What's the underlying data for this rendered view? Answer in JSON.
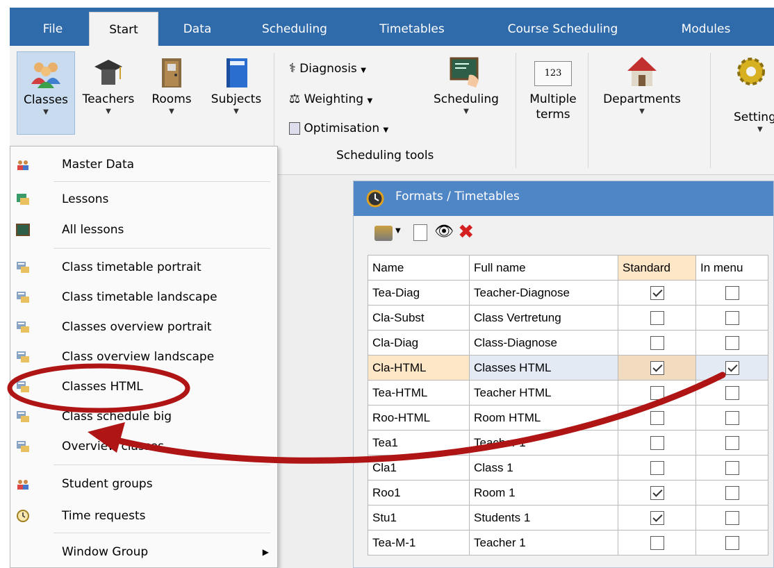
{
  "menubar": {
    "tabs": [
      "File",
      "Start",
      "Data",
      "Scheduling",
      "Timetables",
      "Course Scheduling",
      "Modules"
    ],
    "active_tab": "Start"
  },
  "ribbon": {
    "buttons": {
      "classes": "Classes",
      "teachers": "Teachers",
      "rooms": "Rooms",
      "subjects": "Subjects",
      "scheduling": "Scheduling",
      "multiple_terms_line1": "Multiple",
      "multiple_terms_line2": "terms",
      "departments": "Departments",
      "settings": "Setting"
    },
    "tools": {
      "diagnosis": "Diagnosis",
      "weighting": "Weighting",
      "optimisation": "Optimisation"
    },
    "group_label": "Scheduling tools",
    "multiple_terms_icon_text": "123"
  },
  "menu": {
    "items": [
      "Master Data",
      "Lessons",
      "All lessons",
      "Class timetable portrait",
      "Class timetable landscape",
      "Classes overview portrait",
      "Class overview landscape",
      "Classes HTML",
      "Class schedule big",
      "Overview classes",
      "Student groups",
      "Time requests",
      "Window Group"
    ]
  },
  "panel": {
    "title": "Formats / Timetables",
    "columns": [
      "Name",
      "Full name",
      "Standard",
      "In menu"
    ],
    "rows": [
      {
        "name": "Tea-Diag",
        "full": "Teacher-Diagnose",
        "standard": true,
        "in_menu": false
      },
      {
        "name": "Cla-Subst",
        "full": "Class Vertretung",
        "standard": false,
        "in_menu": false
      },
      {
        "name": "Cla-Diag",
        "full": "Class-Diagnose",
        "standard": false,
        "in_menu": false
      },
      {
        "name": "Cla-HTML",
        "full": "Classes HTML",
        "standard": true,
        "in_menu": true
      },
      {
        "name": "Tea-HTML",
        "full": "Teacher HTML",
        "standard": false,
        "in_menu": false
      },
      {
        "name": "Roo-HTML",
        "full": "Room HTML",
        "standard": false,
        "in_menu": false
      },
      {
        "name": "Tea1",
        "full": "Teacher 1",
        "standard": false,
        "in_menu": false
      },
      {
        "name": "Cla1",
        "full": "Class 1",
        "standard": false,
        "in_menu": false
      },
      {
        "name": "Roo1",
        "full": "Room 1",
        "standard": true,
        "in_menu": false
      },
      {
        "name": "Stu1",
        "full": "Students 1",
        "standard": true,
        "in_menu": false
      },
      {
        "name": "Tea-M-1",
        "full": "Teacher 1",
        "standard": false,
        "in_menu": false
      }
    ],
    "selected_row": 3
  },
  "colors": {
    "menubar": "#2f6aab",
    "title_bar": "#4f86c6",
    "highlight": "#fde7c7",
    "annotation": "#b01515"
  }
}
